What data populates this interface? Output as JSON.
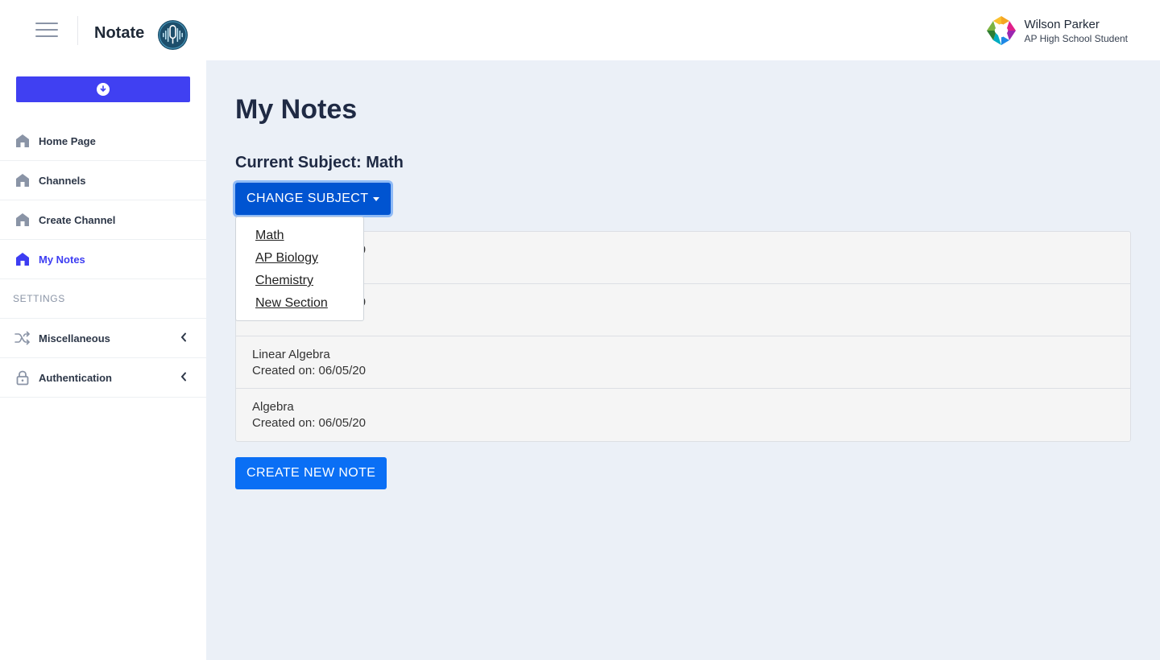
{
  "header": {
    "app_name": "Notate",
    "user": {
      "name": "Wilson Parker",
      "role": "AP High School Student"
    }
  },
  "sidebar": {
    "items": [
      {
        "label": "Home Page",
        "icon": "home-icon",
        "active": false
      },
      {
        "label": "Channels",
        "icon": "home-icon",
        "active": false
      },
      {
        "label": "Create Channel",
        "icon": "home-icon",
        "active": false
      },
      {
        "label": "My Notes",
        "icon": "home-icon",
        "active": true
      }
    ],
    "section_label": "SETTINGS",
    "settings_items": [
      {
        "label": "Miscellaneous",
        "icon": "shuffle-icon"
      },
      {
        "label": "Authentication",
        "icon": "lock-icon"
      }
    ]
  },
  "main": {
    "title": "My Notes",
    "current_subject": "Current Subject: Math",
    "change_subject_label": "CHANGE SUBJECT",
    "dropdown_options": [
      "Math",
      "AP Biology",
      "Chemistry",
      "New Section"
    ],
    "notes": [
      {
        "title": "",
        "date": "Created on: 06/05/20"
      },
      {
        "title": "",
        "date": "Created on: 06/05/20"
      },
      {
        "title": "Linear Algebra",
        "date": "Created on: 06/05/20"
      },
      {
        "title": "Algebra",
        "date": "Created on: 06/05/20"
      }
    ],
    "create_note_label": "CREATE NEW NOTE"
  },
  "colors": {
    "primary_button": "#4040f2",
    "active_nav": "#3d3df2",
    "change_subject_bg": "#0054d1",
    "create_note_bg": "#0a6ff5",
    "main_bg": "#ebf0f7"
  }
}
